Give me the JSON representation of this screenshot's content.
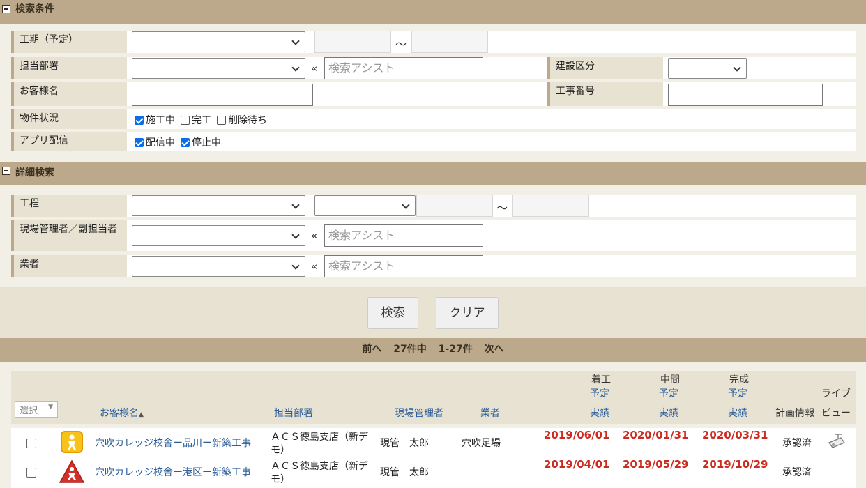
{
  "search_conditions": {
    "title": "検索条件",
    "koki_label": "工期（予定）",
    "tilde": "～",
    "dept_label": "担当部署",
    "chev": "«",
    "assist_placeholder": "検索アシスト",
    "kensetsu_label": "建設区分",
    "customer_label": "お客様名",
    "koji_label": "工事番号",
    "status_label": "物件状況",
    "status_options": [
      {
        "label": "施工中",
        "checked": true
      },
      {
        "label": "完工",
        "checked": false
      },
      {
        "label": "削除待ち",
        "checked": false
      }
    ],
    "app_label": "アプリ配信",
    "app_options": [
      {
        "label": "配信中",
        "checked": true
      },
      {
        "label": "停止中",
        "checked": true
      }
    ]
  },
  "detail_search": {
    "title": "詳細検索",
    "process_label": "工程",
    "manager_label": "現場管理者／副担当者",
    "vendor_label": "業者"
  },
  "buttons": {
    "search": "検索",
    "clear": "クリア"
  },
  "pager": {
    "prev": "前へ",
    "count": "27件中",
    "range": "1-27件",
    "next": "次へ"
  },
  "table": {
    "select_label": "選択",
    "select_arrow": "▼",
    "headers": {
      "customer": "お客様名",
      "sort_arrow": "▲",
      "dept": "担当部署",
      "manager": "現場管理者",
      "vendor": "業者",
      "start": "着工",
      "middle": "中間",
      "complete": "完成",
      "planned": "予定",
      "actual": "実績",
      "plan_info": "計画情報",
      "live_view_1": "ライブ",
      "live_view_2": "ビュー"
    },
    "rows": [
      {
        "customer": "穴吹カレッジ校舎ー品川ー新築工事",
        "dept_line1": "ＡＣＳ徳島支店（新デ",
        "dept_line2": "モ）",
        "manager": "現管　太郎",
        "vendor": "穴吹足場",
        "start": "2019/06/01",
        "middle": "2020/01/31",
        "complete": "2020/03/31",
        "plan_info": "承認済"
      },
      {
        "customer": "穴吹カレッジ校舎ー港区ー新築工事",
        "dept_line1": "ＡＣＳ徳島支店（新デ",
        "dept_line2": "モ）",
        "manager": "現管　太郎",
        "vendor": "",
        "start": "2019/04/01",
        "middle": "2019/05/29",
        "complete": "2019/10/29",
        "plan_info": "承認済"
      }
    ]
  }
}
